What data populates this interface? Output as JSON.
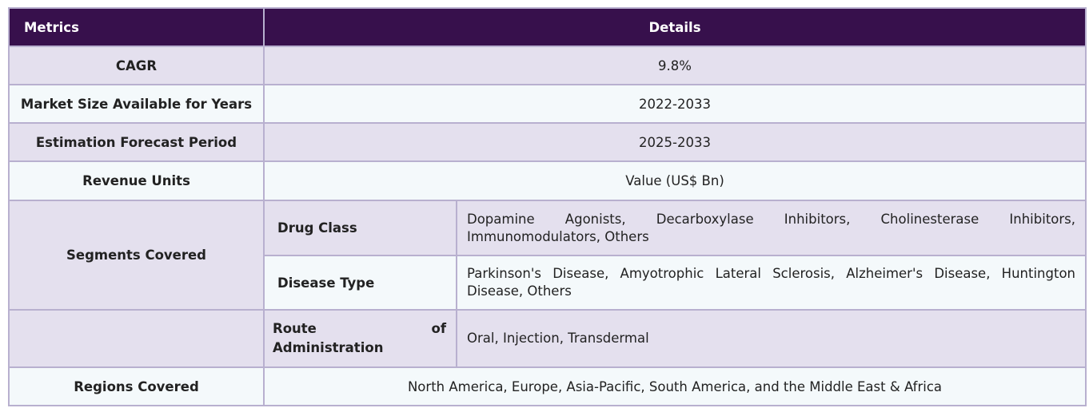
{
  "header": {
    "metrics": "Metrics",
    "details": "Details"
  },
  "rows": {
    "cagr": {
      "label": "CAGR",
      "value": "9.8%"
    },
    "market_size": {
      "label": "Market Size Available for Years",
      "value": "2022-2033"
    },
    "forecast": {
      "label": "Estimation Forecast Period",
      "value": "2025-2033"
    },
    "revenue_units": {
      "label": "Revenue Units",
      "value": "Value (US$ Bn)"
    },
    "segments": {
      "label": "Segments Covered",
      "drug_class": {
        "label": "Drug Class",
        "value": "Dopamine Agonists, Decarboxylase Inhibitors, Cholinesterase Inhibitors, Immunomodulators, Others"
      },
      "disease_type": {
        "label": "Disease Type",
        "value": "Parkinson's Disease, Amyotrophic Lateral Sclerosis, Alzheimer's Disease, Huntington Disease, Others"
      },
      "route": {
        "label": "Route of Administration",
        "value": "Oral, Injection, Transdermal"
      }
    },
    "regions": {
      "label": "Regions Covered",
      "value": "North America, Europe, Asia-Pacific, South America, and the Middle East & Africa"
    }
  },
  "colors": {
    "header_bg": "#37104c",
    "row_alt": "#e4e0ee",
    "row_plain": "#f4f9fb",
    "border": "#b8b0cf"
  }
}
